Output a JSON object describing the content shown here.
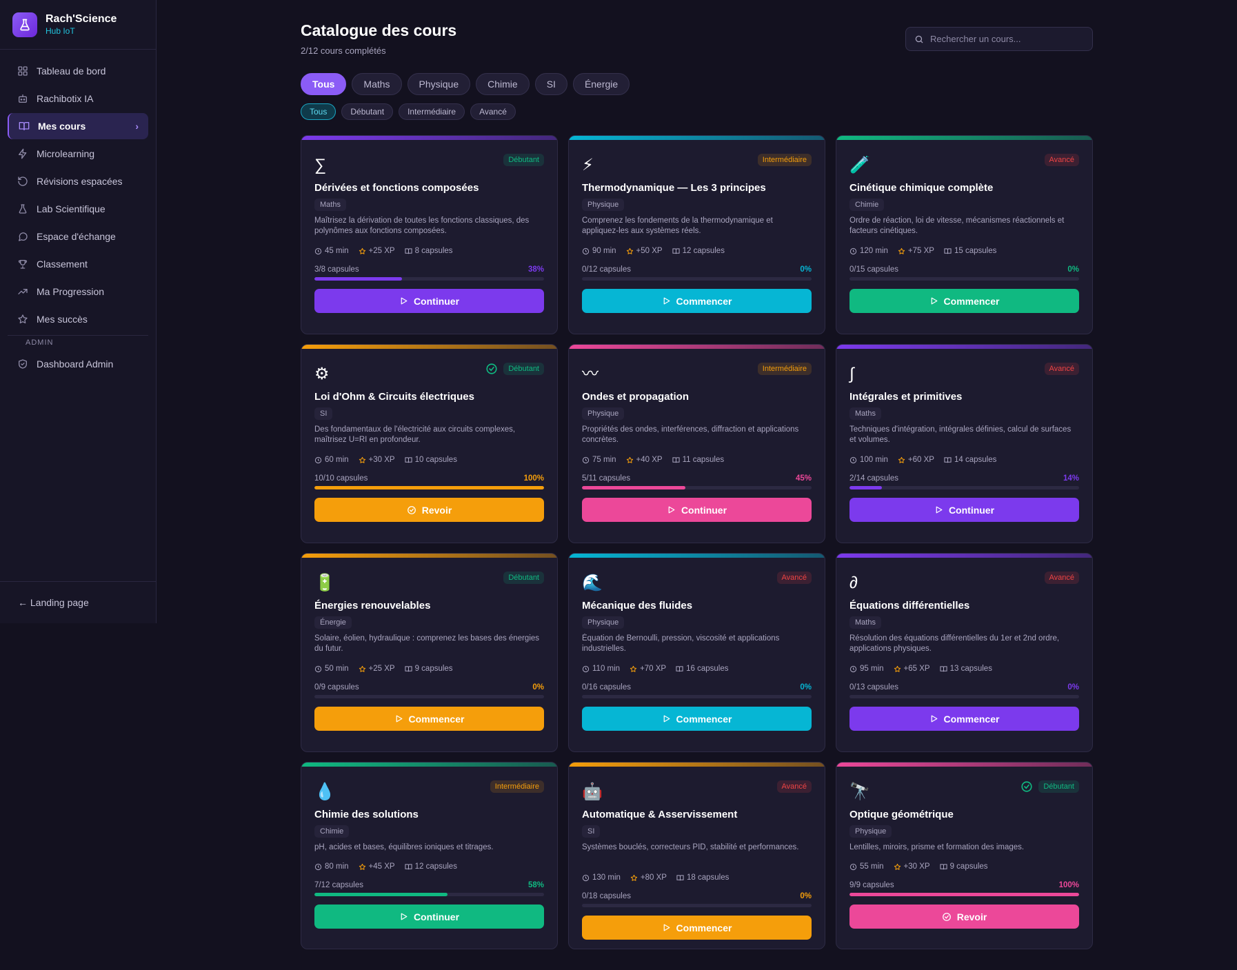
{
  "brand": {
    "name": "Rach'Science",
    "sub": "Hub IoT"
  },
  "nav": {
    "items": [
      {
        "label": "Tableau de bord",
        "icon": "dashboard-icon"
      },
      {
        "label": "Rachibotix IA",
        "icon": "bot-icon"
      },
      {
        "label": "Mes cours",
        "icon": "book-icon",
        "active": true
      },
      {
        "label": "Microlearning",
        "icon": "zap-icon"
      },
      {
        "label": "Révisions espacées",
        "icon": "rotate-icon"
      },
      {
        "label": "Lab Scientifique",
        "icon": "flask-icon"
      },
      {
        "label": "Espace d'échange",
        "icon": "chat-icon"
      },
      {
        "label": "Classement",
        "icon": "trophy-icon"
      },
      {
        "label": "Ma Progression",
        "icon": "trend-icon"
      },
      {
        "label": "Mes succès",
        "icon": "star-icon"
      }
    ],
    "admin_section": "ADMIN",
    "admin_item": {
      "label": "Dashboard Admin",
      "icon": "shield-icon"
    },
    "footer_link": "← Landing page"
  },
  "header": {
    "title": "Catalogue des cours",
    "subtitle": "2/12 cours complétés"
  },
  "search": {
    "placeholder": "Rechercher un cours..."
  },
  "subject_filters": [
    "Tous",
    "Maths",
    "Physique",
    "Chimie",
    "SI",
    "Énergie"
  ],
  "level_filters": [
    "Tous",
    "Débutant",
    "Intermédiaire",
    "Avancé"
  ],
  "colors": {
    "accent": "#8b5cf6",
    "cyan": "#06b6d4",
    "green": "#10b981",
    "orange": "#f59e0b",
    "pink": "#ec4899",
    "beginner": "#10b981",
    "intermediate": "#f59e0b",
    "advanced": "#ef4444"
  },
  "courses": [
    {
      "emoji": "∑",
      "level": "Débutant",
      "title": "Dérivées et fonctions composées",
      "subject": "Maths",
      "description": "Maîtrisez la dérivation de toutes les fonctions classiques, des polynômes aux fonctions composées.",
      "duration": "45 min",
      "xp": "+25 XP",
      "capsules": "8 capsules",
      "progress_label": "3/8 capsules",
      "percent": "38%",
      "progress": 38,
      "action": "Continuer",
      "color": "#7c3aed",
      "completed": false
    },
    {
      "emoji": "⚡",
      "level": "Intermédiaire",
      "title": "Thermodynamique — Les 3 principes",
      "subject": "Physique",
      "description": "Comprenez les fondements de la thermodynamique et appliquez-les aux systèmes réels.",
      "duration": "90 min",
      "xp": "+50 XP",
      "capsules": "12 capsules",
      "progress_label": "0/12 capsules",
      "percent": "0%",
      "progress": 0,
      "action": "Commencer",
      "color": "#06b6d4",
      "completed": false
    },
    {
      "emoji": "🧪",
      "level": "Avancé",
      "title": "Cinétique chimique complète",
      "subject": "Chimie",
      "description": "Ordre de réaction, loi de vitesse, mécanismes réactionnels et facteurs cinétiques.",
      "duration": "120 min",
      "xp": "+75 XP",
      "capsules": "15 capsules",
      "progress_label": "0/15 capsules",
      "percent": "0%",
      "progress": 0,
      "action": "Commencer",
      "color": "#10b981",
      "completed": false
    },
    {
      "emoji": "⚙",
      "level": "Débutant",
      "title": "Loi d'Ohm & Circuits électriques",
      "subject": "SI",
      "description": "Des fondamentaux de l'électricité aux circuits complexes, maîtrisez U=RI en profondeur.",
      "duration": "60 min",
      "xp": "+30 XP",
      "capsules": "10 capsules",
      "progress_label": "10/10 capsules",
      "percent": "100%",
      "progress": 100,
      "action": "Revoir",
      "color": "#f59e0b",
      "completed": true
    },
    {
      "emoji": "〰",
      "level": "Intermédiaire",
      "title": "Ondes et propagation",
      "subject": "Physique",
      "description": "Propriétés des ondes, interférences, diffraction et applications concrètes.",
      "duration": "75 min",
      "xp": "+40 XP",
      "capsules": "11 capsules",
      "progress_label": "5/11 capsules",
      "percent": "45%",
      "progress": 45,
      "action": "Continuer",
      "color": "#ec4899",
      "completed": false
    },
    {
      "emoji": "∫",
      "level": "Avancé",
      "title": "Intégrales et primitives",
      "subject": "Maths",
      "description": "Techniques d'intégration, intégrales définies, calcul de surfaces et volumes.",
      "duration": "100 min",
      "xp": "+60 XP",
      "capsules": "14 capsules",
      "progress_label": "2/14 capsules",
      "percent": "14%",
      "progress": 14,
      "action": "Continuer",
      "color": "#7c3aed",
      "completed": false
    },
    {
      "emoji": "🔋",
      "level": "Débutant",
      "title": "Énergies renouvelables",
      "subject": "Énergie",
      "description": "Solaire, éolien, hydraulique : comprenez les bases des énergies du futur.",
      "duration": "50 min",
      "xp": "+25 XP",
      "capsules": "9 capsules",
      "progress_label": "0/9 capsules",
      "percent": "0%",
      "progress": 0,
      "action": "Commencer",
      "color": "#f59e0b",
      "completed": false
    },
    {
      "emoji": "🌊",
      "level": "Avancé",
      "title": "Mécanique des fluides",
      "subject": "Physique",
      "description": "Équation de Bernoulli, pression, viscosité et applications industrielles.",
      "duration": "110 min",
      "xp": "+70 XP",
      "capsules": "16 capsules",
      "progress_label": "0/16 capsules",
      "percent": "0%",
      "progress": 0,
      "action": "Commencer",
      "color": "#06b6d4",
      "completed": false
    },
    {
      "emoji": "∂",
      "level": "Avancé",
      "title": "Équations différentielles",
      "subject": "Maths",
      "description": "Résolution des équations différentielles du 1er et 2nd ordre, applications physiques.",
      "duration": "95 min",
      "xp": "+65 XP",
      "capsules": "13 capsules",
      "progress_label": "0/13 capsules",
      "percent": "0%",
      "progress": 0,
      "action": "Commencer",
      "color": "#7c3aed",
      "completed": false
    },
    {
      "emoji": "💧",
      "level": "Intermédiaire",
      "title": "Chimie des solutions",
      "subject": "Chimie",
      "description": "pH, acides et bases, équilibres ioniques et titrages.",
      "duration": "80 min",
      "xp": "+45 XP",
      "capsules": "12 capsules",
      "progress_label": "7/12 capsules",
      "percent": "58%",
      "progress": 58,
      "action": "Continuer",
      "color": "#10b981",
      "completed": false
    },
    {
      "emoji": "🤖",
      "level": "Avancé",
      "title": "Automatique & Asservissement",
      "subject": "SI",
      "description": "Systèmes bouclés, correcteurs PID, stabilité et performances.",
      "duration": "130 min",
      "xp": "+80 XP",
      "capsules": "18 capsules",
      "progress_label": "0/18 capsules",
      "percent": "0%",
      "progress": 0,
      "action": "Commencer",
      "color": "#f59e0b",
      "completed": false
    },
    {
      "emoji": "🔭",
      "level": "Débutant",
      "title": "Optique géométrique",
      "subject": "Physique",
      "description": "Lentilles, miroirs, prisme et formation des images.",
      "duration": "55 min",
      "xp": "+30 XP",
      "capsules": "9 capsules",
      "progress_label": "9/9 capsules",
      "percent": "100%",
      "progress": 100,
      "action": "Revoir",
      "color": "#ec4899",
      "completed": true
    }
  ]
}
